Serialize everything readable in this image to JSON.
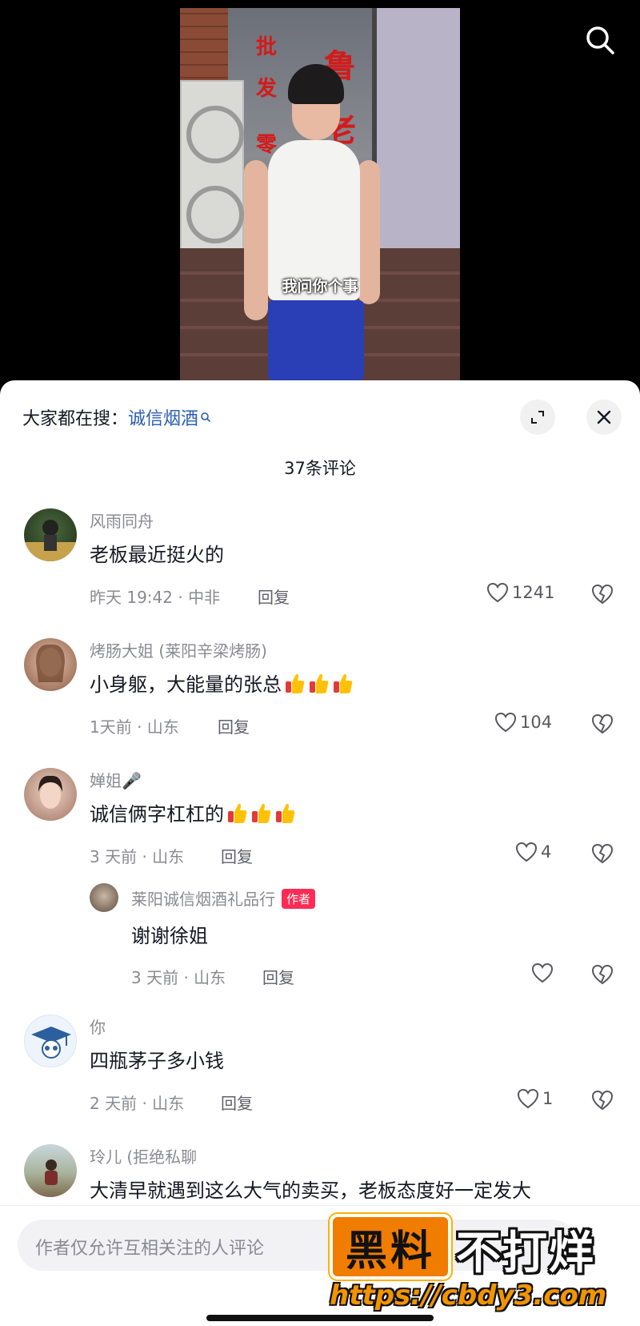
{
  "video": {
    "subtitle": "我问你个事",
    "sign_left": [
      "批",
      "发",
      "零"
    ],
    "sign_right": [
      "鲁",
      "老"
    ],
    "search_icon": "search-icon"
  },
  "sheet": {
    "hot_search_prefix": "大家都在搜：",
    "hot_search_keyword": "诚信烟酒",
    "comment_count": "37条评论"
  },
  "comments": [
    {
      "name": "风雨同舟",
      "text": "老板最近挺火的",
      "meta": "昨天 19:42 · 中非",
      "reply_label": "回复",
      "likes": "1241"
    },
    {
      "name": "烤肠大姐 (莱阳辛梁烤肠)",
      "text": "小身躯，大能量的张总",
      "meta": "1天前 · 山东",
      "reply_label": "回复",
      "likes": "104",
      "emoji_count": 3
    },
    {
      "name": "婵姐🎤",
      "text": "诚信俩字杠杠的",
      "meta": "3 天前 · 山东",
      "reply_label": "回复",
      "likes": "4",
      "emoji_count": 3
    },
    {
      "name": "你",
      "text": "四瓶茅子多小钱",
      "meta": "2 天前 · 山东",
      "reply_label": "回复",
      "likes": "1"
    },
    {
      "name": "玲儿 (拒绝私聊",
      "text": "大清早就遇到这么大气的卖买，老板态度好一定发大"
    }
  ],
  "reply": {
    "name": "莱阳诚信烟酒礼品行",
    "badge": "作者",
    "text": "谢谢徐姐",
    "meta": "3 天前 · 山东",
    "reply_label": "回复"
  },
  "input": {
    "placeholder": "作者仅允许互相关注的人评论"
  },
  "watermark": {
    "left": "黑料",
    "right": "不打烊",
    "url": "https://cbdy3.com"
  },
  "colors": {
    "accent_link": "#2a5db0",
    "author_badge": "#fe2c55",
    "watermark_orange": "#f07c00"
  }
}
